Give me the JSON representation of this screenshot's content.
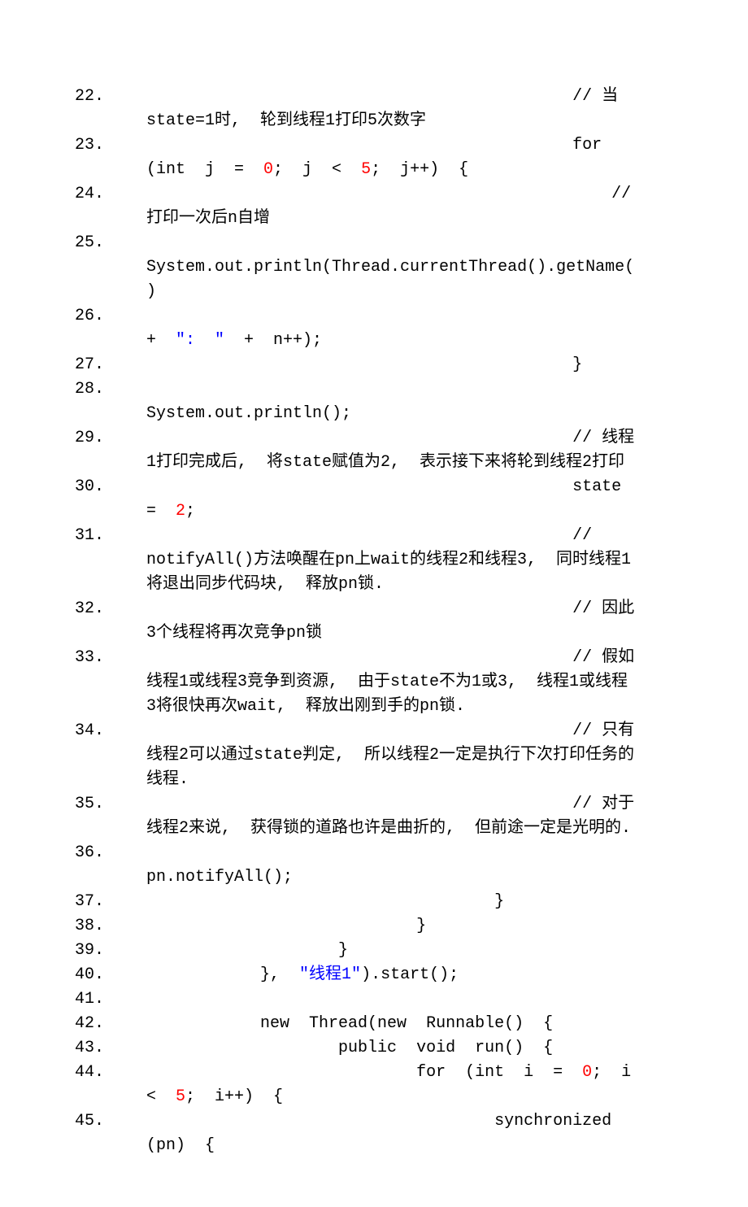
{
  "lines": [
    {
      "n": "22.",
      "pad": "                                            ",
      "segs": [
        {
          "t": "// 当state=1时,  轮到线程1打印5次数字"
        }
      ]
    },
    {
      "n": "23.",
      "pad": "                                            ",
      "segs": [
        {
          "t": "for  (int  j  =  "
        },
        {
          "t": "0",
          "cls": "num"
        },
        {
          "t": ";  j  <  "
        },
        {
          "t": "5",
          "cls": "num"
        },
        {
          "t": ";  j++)  {"
        }
      ]
    },
    {
      "n": "24.",
      "pad": "                                                ",
      "segs": [
        {
          "t": "// 打印一次后n自增"
        }
      ]
    },
    {
      "n": "25.",
      "pad": "                                                ",
      "segs": [
        {
          "t": "System.out.println(Thread.currentThread().getName()"
        }
      ]
    },
    {
      "n": "26.",
      "pad": "                                                        ",
      "segs": [
        {
          "t": "+  "
        },
        {
          "t": "\":  \"",
          "cls": "str"
        },
        {
          "t": "  +  n++);"
        }
      ]
    },
    {
      "n": "27.",
      "pad": "                                            ",
      "segs": [
        {
          "t": "}"
        }
      ]
    },
    {
      "n": "28.",
      "pad": "                                            ",
      "segs": [
        {
          "t": "System.out.println();"
        }
      ]
    },
    {
      "n": "29.",
      "pad": "                                            ",
      "segs": [
        {
          "t": "// 线程1打印完成后,  将state赋值为2,  表示接下来将轮到线程2打印"
        }
      ]
    },
    {
      "n": "30.",
      "pad": "                                            ",
      "segs": [
        {
          "t": "state  =  "
        },
        {
          "t": "2",
          "cls": "num"
        },
        {
          "t": ";  "
        }
      ]
    },
    {
      "n": "31.",
      "pad": "                                            ",
      "segs": [
        {
          "t": "// notifyAll()方法唤醒在pn上wait的线程2和线程3,  同时线程1将退出同步代码块,  释放pn锁."
        }
      ]
    },
    {
      "n": "32.",
      "pad": "                                            ",
      "segs": [
        {
          "t": "// 因此3个线程将再次竞争pn锁"
        }
      ]
    },
    {
      "n": "33.",
      "pad": "                                            ",
      "segs": [
        {
          "t": "// 假如线程1或线程3竞争到资源,  由于state不为1或3,  线程1或线程3将很快再次wait,  释放出刚到手的pn锁."
        }
      ]
    },
    {
      "n": "34.",
      "pad": "                                            ",
      "segs": [
        {
          "t": "// 只有线程2可以通过state判定,  所以线程2一定是执行下次打印任务的线程."
        }
      ]
    },
    {
      "n": "35.",
      "pad": "                                            ",
      "segs": [
        {
          "t": "// 对于线程2来说,  获得锁的道路也许是曲折的,  但前途一定是光明的."
        }
      ]
    },
    {
      "n": "36.",
      "pad": "                                            ",
      "segs": [
        {
          "t": "pn.notifyAll();  "
        }
      ]
    },
    {
      "n": "37.",
      "pad": "                                    ",
      "segs": [
        {
          "t": "}"
        }
      ]
    },
    {
      "n": "38.",
      "pad": "                            ",
      "segs": [
        {
          "t": "}"
        }
      ]
    },
    {
      "n": "39.",
      "pad": "                    ",
      "segs": [
        {
          "t": "}"
        }
      ]
    },
    {
      "n": "40.",
      "pad": "            ",
      "segs": [
        {
          "t": "},  "
        },
        {
          "t": "\"线程1\"",
          "cls": "str"
        },
        {
          "t": ").start();"
        }
      ]
    },
    {
      "n": "41.",
      "pad": "              ",
      "segs": []
    },
    {
      "n": "42.",
      "pad": "            ",
      "segs": [
        {
          "t": "new  Thread(new  Runnable()  {"
        }
      ]
    },
    {
      "n": "43.",
      "pad": "                    ",
      "segs": [
        {
          "t": "public  void  run()  {"
        }
      ]
    },
    {
      "n": "44.",
      "pad": "                            ",
      "segs": [
        {
          "t": "for  (int  i  =  "
        },
        {
          "t": "0",
          "cls": "num"
        },
        {
          "t": ";  i  <  "
        },
        {
          "t": "5",
          "cls": "num"
        },
        {
          "t": ";  i++)  {"
        }
      ]
    },
    {
      "n": "45.",
      "pad": "                                    ",
      "segs": [
        {
          "t": "synchronized  (pn)  {"
        }
      ]
    }
  ]
}
